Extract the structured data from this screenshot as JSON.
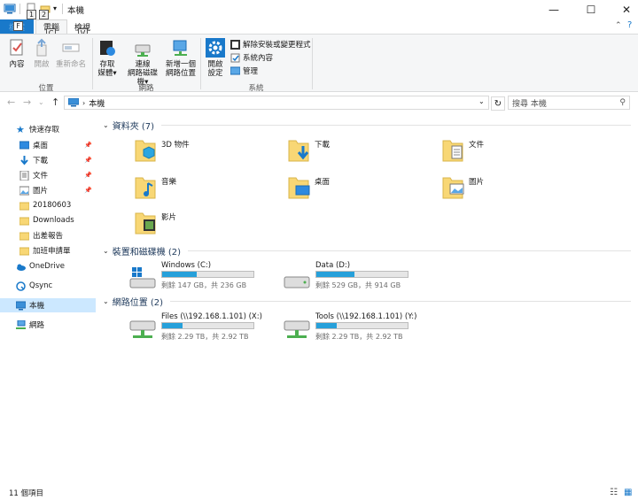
{
  "window": {
    "title": "本機",
    "keytips": [
      "1",
      "2",
      "F",
      "C",
      "V"
    ]
  },
  "tabs": {
    "file": "檔案",
    "computer": "電腦",
    "view": "檢視"
  },
  "ribbon": {
    "location": {
      "label": "位置",
      "properties": "內容",
      "open": "開啟",
      "rename": "重新命名"
    },
    "network": {
      "label": "網路",
      "access_media_1": "存取",
      "access_media_2": "媒體",
      "map_drive_1": "連線",
      "map_drive_2": "網路磁碟機",
      "add_location_1": "新增一個",
      "add_location_2": "網路位置"
    },
    "system": {
      "label": "系統",
      "settings_1": "開啟",
      "settings_2": "設定",
      "uninstall": "解除安裝或變更程式",
      "sys_props": "系統內容",
      "manage": "管理"
    }
  },
  "address": {
    "path": "本機",
    "search_placeholder": "搜尋 本機"
  },
  "nav": {
    "quick_access": "快速存取",
    "desktop": "桌面",
    "downloads": "下載",
    "documents": "文件",
    "pictures": "圖片",
    "f1": "20180603",
    "f2": "Downloads",
    "f3": "出差報告",
    "f4": "加班申請單",
    "onedrive": "OneDrive",
    "qsync": "Qsync",
    "this_pc": "本機",
    "network": "網路"
  },
  "sections": {
    "folders": "資料夾 (7)",
    "devices": "裝置和磁碟機 (2)",
    "netloc": "網路位置 (2)"
  },
  "folders": {
    "objects3d": "3D 物件",
    "downloads": "下載",
    "documents": "文件",
    "music": "音樂",
    "desktop": "桌面",
    "pictures": "圖片",
    "videos": "影片"
  },
  "drives": {
    "c": {
      "name": "Windows (C:)",
      "free": "剩餘 147 GB，共 236 GB",
      "used_fraction": 0.38
    },
    "d": {
      "name": "Data (D:)",
      "free": "剩餘 529 GB，共 914 GB",
      "used_fraction": 0.42
    },
    "x": {
      "name": "Files (\\\\192.168.1.101) (X:)",
      "free": "剩餘 2.29 TB，共 2.92 TB",
      "used_fraction": 0.22
    },
    "y": {
      "name": "Tools (\\\\192.168.1.101) (Y:)",
      "free": "剩餘 2.29 TB，共 2.92 TB",
      "used_fraction": 0.22
    }
  },
  "status": {
    "count": "11 個項目"
  },
  "colors": {
    "accent": "#1979ca",
    "drive_fill": "#26a0da",
    "folder": "#f8d775",
    "selected": "#cce8ff"
  }
}
